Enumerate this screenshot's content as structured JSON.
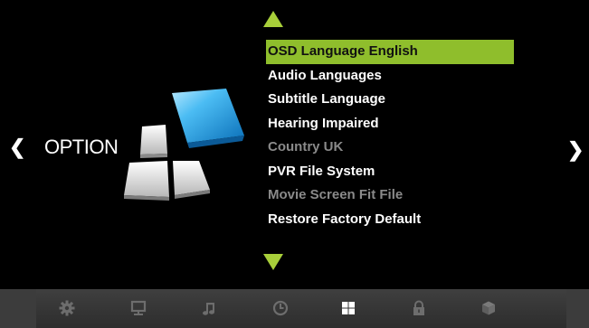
{
  "page": {
    "title": "OPTION"
  },
  "nav": {
    "left_glyph": "❮",
    "right_glyph": "❯"
  },
  "menu": {
    "items": [
      {
        "label": "OSD Language English",
        "state": "selected"
      },
      {
        "label": "Audio Languages",
        "state": "normal"
      },
      {
        "label": "Subtitle Language",
        "state": "normal"
      },
      {
        "label": "Hearing Impaired",
        "state": "normal"
      },
      {
        "label": "Country UK",
        "state": "disabled"
      },
      {
        "label": "PVR File System",
        "state": "normal"
      },
      {
        "label": "Movie Screen Fit File",
        "state": "disabled"
      },
      {
        "label": "Restore Factory Default",
        "state": "normal"
      }
    ]
  },
  "toolbar": {
    "icons": [
      "gear-icon",
      "monitor-icon",
      "music-note-icon",
      "clock-icon",
      "grid-icon",
      "lock-icon",
      "cube-icon"
    ],
    "active": "grid-icon"
  },
  "colors": {
    "accent": "#8fbe2c",
    "arrow": "#a8cf3a",
    "disabled_text": "#8a8a8a"
  }
}
